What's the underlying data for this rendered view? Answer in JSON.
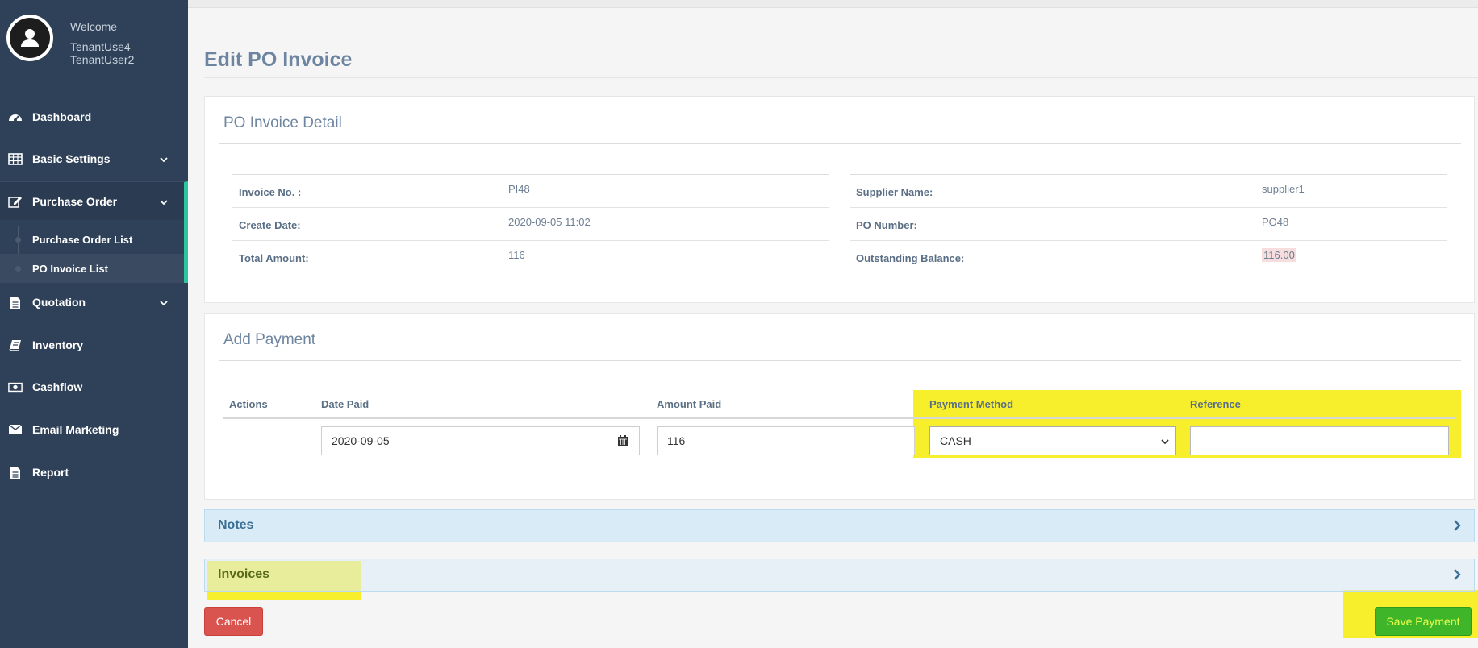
{
  "sidebar": {
    "welcome": "Welcome",
    "user_line1": "TenantUse4",
    "user_line2": "TenantUser2",
    "items": [
      {
        "label": "Dashboard",
        "icon": "dashboard-icon"
      },
      {
        "label": "Basic Settings",
        "icon": "table-icon"
      },
      {
        "label": "Purchase Order",
        "icon": "edit-icon"
      },
      {
        "label": "Quotation",
        "icon": "file-icon"
      },
      {
        "label": "Inventory",
        "icon": "book-icon"
      },
      {
        "label": "Cashflow",
        "icon": "money-icon"
      },
      {
        "label": "Email Marketing",
        "icon": "envelope-icon"
      },
      {
        "label": "Report",
        "icon": "file-icon"
      }
    ],
    "subitems": [
      {
        "label": "Purchase Order List"
      },
      {
        "label": "PO Invoice List"
      }
    ]
  },
  "page": {
    "title": "Edit PO Invoice"
  },
  "detail": {
    "title": "PO Invoice Detail",
    "left": [
      {
        "key": "Invoice No. :",
        "value": "PI48"
      },
      {
        "key": "Create Date:",
        "value": "2020-09-05 11:02"
      },
      {
        "key": "Total Amount:",
        "value": "116"
      }
    ],
    "right": [
      {
        "key": "Supplier Name:",
        "value": "supplier1"
      },
      {
        "key": "PO Number:",
        "value": "PO48"
      },
      {
        "key": "Outstanding Balance:",
        "value": "116.00"
      }
    ]
  },
  "payment": {
    "title": "Add Payment",
    "headers": {
      "actions": "Actions",
      "date_paid": "Date Paid",
      "amount_paid": "Amount Paid",
      "method": "Payment Method",
      "reference": "Reference"
    },
    "date_value": "2020-09-05",
    "amount_value": "116",
    "method_value": "CASH",
    "reference_value": ""
  },
  "accordions": {
    "notes": "Notes",
    "invoices": "Invoices"
  },
  "buttons": {
    "cancel": "Cancel",
    "save": "Save Payment"
  },
  "colors": {
    "sidebar_bg": "#2f4158",
    "accent": "#2ec4a0",
    "highlight": "#f8ef2c",
    "cancel": "#d9534f",
    "save": "#3fb52a"
  }
}
